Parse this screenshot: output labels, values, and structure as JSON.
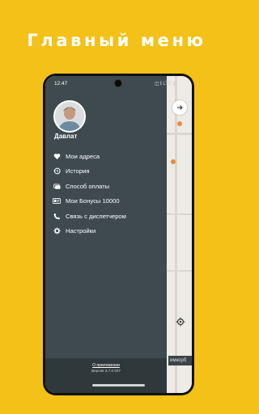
{
  "promo": {
    "title": "Главный меню"
  },
  "status_bar": {
    "time": "12:47",
    "icons": "◫ 𝄃 LTE ▮"
  },
  "user": {
    "name": "Давлат"
  },
  "menu": {
    "items": [
      {
        "label": "Мои адреса",
        "icon": "heart-icon"
      },
      {
        "label": "История",
        "icon": "history-icon"
      },
      {
        "label": "Способ оплаты",
        "icon": "card-icon"
      },
      {
        "label": "Мои Бонусы 10000",
        "icon": "bonus-icon"
      },
      {
        "label": "Связь с диспетчером",
        "icon": "phone-icon"
      },
      {
        "label": "Настройки",
        "icon": "gear-icon"
      }
    ]
  },
  "drawer_footer": {
    "about_link": "О приложении",
    "version": "Версия 3.7.0.937"
  },
  "map": {
    "street_label": "имкорб"
  },
  "colors": {
    "background": "#f3c117",
    "drawer": "#3e4a4e",
    "accent_pin": "#e98a3c"
  }
}
